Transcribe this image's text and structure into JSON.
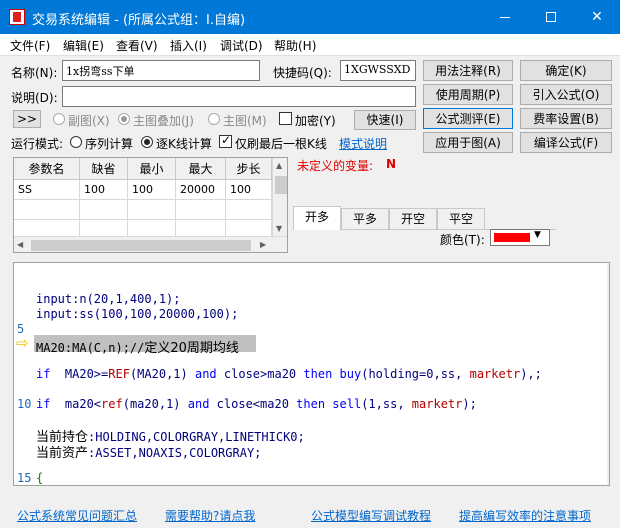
{
  "window": {
    "title": "交易系统编辑 - (所属公式组：I.自编)",
    "icon": "formula-app-icon",
    "controls": {
      "minimize": "—",
      "maximize": "☐",
      "close": "✕"
    }
  },
  "menu": [
    "文件(F)",
    "编辑(E)",
    "查看(V)",
    "插入(I)",
    "调试(D)",
    "帮助(H)"
  ],
  "form": {
    "name_label": "名称(N):",
    "name_value": "1x拐弯ss下单",
    "shortcut_label": "快捷码(Q):",
    "shortcut_value": "1XGWSSXD",
    "desc_label": "说明(D):",
    "desc_value": "",
    "expand_button": ">>",
    "chart_options": [
      {
        "label": "副图(X)",
        "checked": false,
        "disabled": true
      },
      {
        "label": "主图叠加(J)",
        "checked": true,
        "disabled": true
      },
      {
        "label": "主图(M)",
        "checked": false,
        "disabled": true
      }
    ],
    "encrypt_label": "加密(Y)",
    "fast_button": "快速(I)",
    "run_mode_label": "运行模式:",
    "run_modes": [
      {
        "label": "序列计算",
        "checked": false
      },
      {
        "label": "逐K线计算",
        "checked": true
      }
    ],
    "last_bar_label": "仅刷最后一根K线",
    "last_bar_checked": true,
    "mode_help_link": "模式说明"
  },
  "right_buttons": [
    "用法注释(R)",
    "确定(K)",
    "使用周期(P)",
    "引入公式(O)",
    "公式测评(E)",
    "费率设置(B)",
    "应用于图(A)",
    "编译公式(F)"
  ],
  "params_table": {
    "headers": [
      "参数名",
      "缺省",
      "最小",
      "最大",
      "步长"
    ],
    "rows": [
      [
        "SS",
        "100",
        "100",
        "20000",
        "100"
      ]
    ]
  },
  "undefined_vars_label": "未定义的变量:",
  "undefined_vars_value": "N",
  "signal_tabs": [
    "开多",
    "平多",
    "开空",
    "平空"
  ],
  "color_label": "颜色(T):",
  "color_value": "#ff0000",
  "code": {
    "line1": "input:n(20,1,400,1);",
    "line2": "input:ss(100,100,20000,100);",
    "ln5": "5",
    "ma_code": "MA20:MA(C,n);//",
    "ma_comment": "定义20周期均线",
    "buy_if": "if",
    "buy_cond": "MA20>=",
    "buy_ref": "REF",
    "buy_mid": "(MA20,1)",
    "buy_and": "and",
    "buy_close": "close>ma20",
    "buy_then": "then",
    "buy_fn": "buy",
    "buy_args": "(holding=0,ss,",
    "buy_mkt": "marketr",
    "buy_end": "),;",
    "ln10": "10",
    "sell_if": "if",
    "sell_cond": "ma20<",
    "sell_ref": "ref",
    "sell_mid": "(ma20,1)",
    "sell_and": "and",
    "sell_close": "close<ma20",
    "sell_then": "then",
    "sell_fn": "sell",
    "sell_args": "(1,ss,",
    "sell_mkt": "marketr",
    "sell_end": ");",
    "hold_label": "当前持仓",
    "hold_code": ":HOLDING,COLORGRAY,LINETHICK0;",
    "asset_label": "当前资产",
    "asset_code": ":ASSET,NOAXIS,COLORGRAY;",
    "ln15": "15",
    "brace": "{"
  },
  "footer_links": [
    "公式系统常见问题汇总",
    "需要帮助?请点我",
    "公式模型编写调试教程",
    "提高编写效率的注意事项"
  ]
}
